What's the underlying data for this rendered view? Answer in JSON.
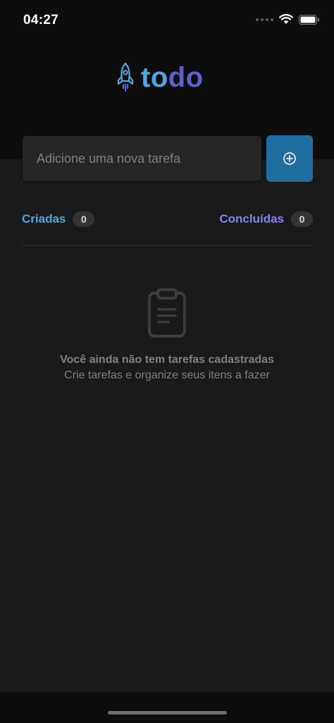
{
  "status_bar": {
    "time": "04:27",
    "icons": [
      "signal-dots-icon",
      "wifi-icon",
      "battery-icon"
    ]
  },
  "header": {
    "logo_icon": "rocket-icon",
    "logo_part1": "to",
    "logo_part2": "do",
    "colors": {
      "blue": "#4ea8de",
      "purple": "#5e60ce"
    }
  },
  "new_task": {
    "placeholder": "Adicione uma nova tarefa",
    "value": "",
    "add_icon": "plus-circle-icon"
  },
  "counters": {
    "created": {
      "label": "Criadas",
      "count": "0"
    },
    "done": {
      "label": "Concluídas",
      "count": "0"
    }
  },
  "empty_state": {
    "icon": "clipboard-icon",
    "title": "Você ainda não tem tarefas cadastradas",
    "subtitle": "Crie tarefas e organize seus itens a fazer"
  },
  "colors": {
    "background": "#1a1a1a",
    "header_background": "#0d0d0d",
    "input_background": "#262626",
    "button": "#1e6f9f",
    "created_label": "#4ea8de",
    "done_label": "#8284fa",
    "badge": "#333333",
    "muted_text": "#808080"
  }
}
